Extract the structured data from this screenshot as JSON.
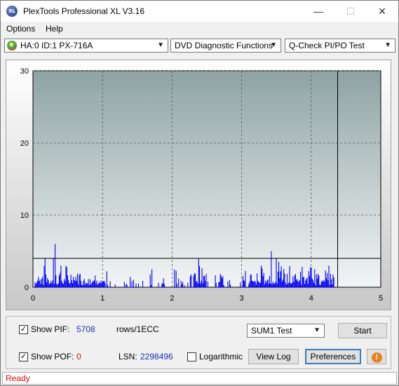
{
  "window": {
    "title": "PlexTools Professional XL V3.16",
    "icon_text": "XL"
  },
  "menu": {
    "options": "Options",
    "help": "Help"
  },
  "toolbar": {
    "drive": "HA:0 ID:1  PX-716A",
    "function": "DVD Diagnostic Functions",
    "test": "Q-Check PI/PO Test"
  },
  "chart_data": {
    "type": "bar",
    "x_ticks": [
      "0",
      "1",
      "2",
      "3",
      "4",
      "5"
    ],
    "y_ticks": [
      "0",
      "10",
      "20",
      "30"
    ],
    "xlim": [
      0,
      5
    ],
    "ylim": [
      0,
      30
    ],
    "threshold_line": 4,
    "end_marker_x": 4.38,
    "grid": true,
    "colors": {
      "bars": "#0000ff",
      "plot_bg_top": "#8fa3a4",
      "plot_bg_bottom": "#f2f5f5"
    }
  },
  "controls": {
    "show_pif_label": "Show PIF:",
    "pif_value": "5708",
    "pif_unit": "rows/1ECC",
    "show_pof_label": "Show POF:",
    "pof_value": "0",
    "lsn_label": "LSN:",
    "lsn_value": "2298496",
    "logarithmic_label": "Logarithmic",
    "test_select": "SUM1 Test",
    "start_button": "Start",
    "view_log_button": "View Log",
    "preferences_button": "Preferences",
    "info_icon": "info-icon"
  },
  "status": {
    "text": "Ready"
  }
}
